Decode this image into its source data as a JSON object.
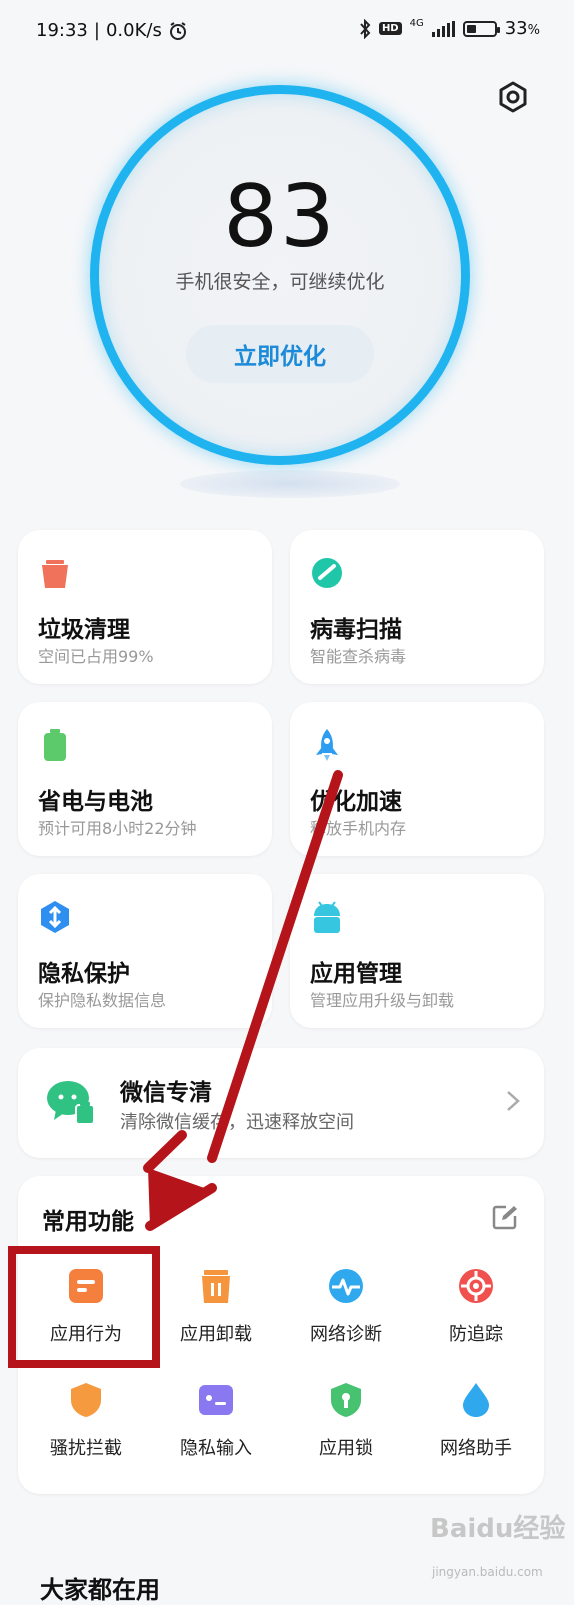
{
  "status_bar": {
    "time": "19:33",
    "speed": "0.0K/s",
    "network": "4G",
    "battery_percent": "33",
    "battery_unit": "%",
    "battery_level": 0.33
  },
  "score": {
    "value": "83",
    "description": "手机很安全，可继续优化",
    "button_label": "立即优化",
    "ring_color": "#1fb4f0"
  },
  "tiles": [
    {
      "title": "垃圾清理",
      "subtitle": "空间已占用99%",
      "icon": "trash-icon",
      "color": "#f0725a"
    },
    {
      "title": "病毒扫描",
      "subtitle": "智能查杀病毒",
      "icon": "shield-scan-icon",
      "color": "#1fc7a8"
    },
    {
      "title": "省电与电池",
      "subtitle": "预计可用8小时22分钟",
      "icon": "battery-icon",
      "color": "#5cc96a"
    },
    {
      "title": "优化加速",
      "subtitle": "释放手机内存",
      "icon": "rocket-icon",
      "color": "#2e9cf0"
    },
    {
      "title": "隐私保护",
      "subtitle": "保护隐私数据信息",
      "icon": "privacy-icon",
      "color": "#2e8ff0"
    },
    {
      "title": "应用管理",
      "subtitle": "管理应用升级与卸载",
      "icon": "android-icon",
      "color": "#36c6e0"
    }
  ],
  "wechat": {
    "title": "微信专清",
    "subtitle": "清除微信缓存，迅速释放空间"
  },
  "features": {
    "title": "常用功能",
    "items": [
      {
        "label": "应用行为",
        "icon": "app-behavior-icon",
        "color": "#f5803e"
      },
      {
        "label": "应用卸载",
        "icon": "uninstall-icon",
        "color": "#f5953e"
      },
      {
        "label": "网络诊断",
        "icon": "network-diagnose-icon",
        "color": "#2fa8ee"
      },
      {
        "label": "防追踪",
        "icon": "anti-track-icon",
        "color": "#f0514e"
      },
      {
        "label": "骚扰拦截",
        "icon": "block-shield-icon",
        "color": "#f59a3e"
      },
      {
        "label": "隐私输入",
        "icon": "privacy-input-icon",
        "color": "#8a78f0"
      },
      {
        "label": "应用锁",
        "icon": "app-lock-icon",
        "color": "#46c271"
      },
      {
        "label": "网络助手",
        "icon": "water-drop-icon",
        "color": "#2fa8ee"
      }
    ]
  },
  "bottom_section": {
    "title": "大家都在用"
  },
  "watermark": {
    "logo_text": "Baidu经验",
    "url_text": "jingyan.baidu.com"
  },
  "annotation": {
    "color": "#b5151a"
  }
}
